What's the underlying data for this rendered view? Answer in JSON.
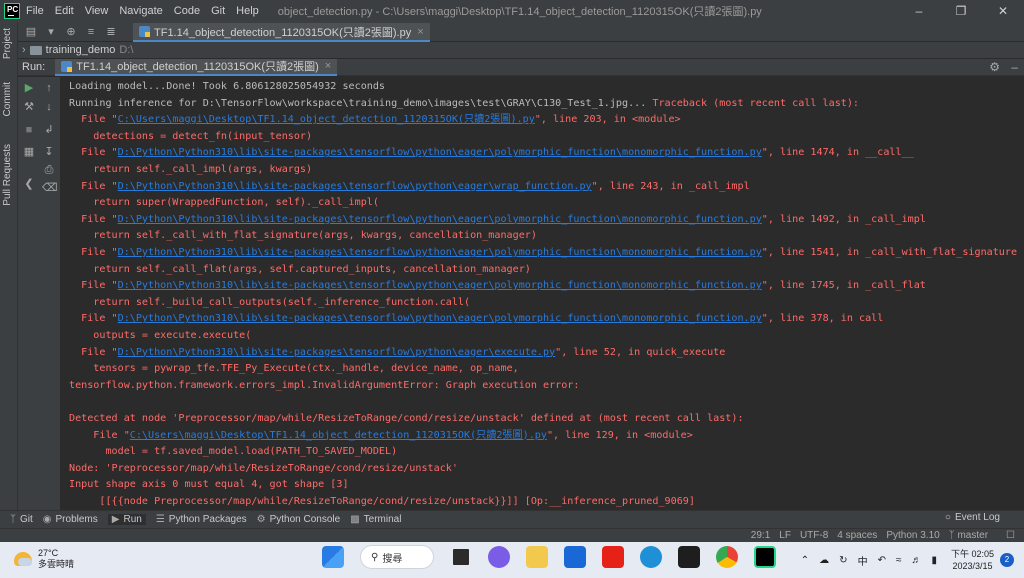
{
  "window": {
    "title": "object_detection.py - C:\\Users\\maggi\\Desktop\\TF1.14_object_detection_1120315OK(只讀2張圖).py",
    "menu": [
      "File",
      "Edit",
      "View",
      "Navigate",
      "Code",
      "Git",
      "Help"
    ]
  },
  "editor_tab": {
    "label": "TF1.14_object_detection_1120315OK(只讀2張圖).py"
  },
  "breadcrumb": {
    "project": "training_demo",
    "drive": "D:\\"
  },
  "left_strip": {
    "project": "Project",
    "commit": "Commit",
    "pull_requests": "Pull Requests"
  },
  "run_panel": {
    "label": "Run:",
    "tab": "TF1.14_object_detection_1120315OK(只讀2張圖)"
  },
  "console": [
    [
      {
        "t": "Loading model...Done! Took 6.806128025054932 seconds",
        "c": "norm"
      }
    ],
    [
      {
        "t": "Running inference for D:\\TensorFlow\\workspace\\training_demo\\images\\test\\GRAY\\C130_Test_1.jpg... ",
        "c": "norm"
      },
      {
        "t": "Traceback (most recent call last):",
        "c": "err"
      }
    ],
    [
      {
        "t": "  File \"",
        "c": "err"
      },
      {
        "t": "C:\\Users\\maggi\\Desktop\\TF1.14_object_detection_1120315OK(只讀2張圖).py",
        "c": "link"
      },
      {
        "t": "\", line 203, in <module>",
        "c": "err"
      }
    ],
    [
      {
        "t": "    detections = detect_fn(input_tensor)",
        "c": "err"
      }
    ],
    [
      {
        "t": "  File \"",
        "c": "err"
      },
      {
        "t": "D:\\Python\\Python310\\lib\\site-packages\\tensorflow\\python\\eager\\polymorphic_function\\monomorphic_function.py",
        "c": "link"
      },
      {
        "t": "\", line 1474, in __call__",
        "c": "err"
      }
    ],
    [
      {
        "t": "    return self._call_impl(args, kwargs)",
        "c": "err"
      }
    ],
    [
      {
        "t": "  File \"",
        "c": "err"
      },
      {
        "t": "D:\\Python\\Python310\\lib\\site-packages\\tensorflow\\python\\eager\\wrap_function.py",
        "c": "link"
      },
      {
        "t": "\", line 243, in _call_impl",
        "c": "err"
      }
    ],
    [
      {
        "t": "    return super(WrappedFunction, self)._call_impl(",
        "c": "err"
      }
    ],
    [
      {
        "t": "  File \"",
        "c": "err"
      },
      {
        "t": "D:\\Python\\Python310\\lib\\site-packages\\tensorflow\\python\\eager\\polymorphic_function\\monomorphic_function.py",
        "c": "link"
      },
      {
        "t": "\", line 1492, in _call_impl",
        "c": "err"
      }
    ],
    [
      {
        "t": "    return self._call_with_flat_signature(args, kwargs, cancellation_manager)",
        "c": "err"
      }
    ],
    [
      {
        "t": "  File \"",
        "c": "err"
      },
      {
        "t": "D:\\Python\\Python310\\lib\\site-packages\\tensorflow\\python\\eager\\polymorphic_function\\monomorphic_function.py",
        "c": "link"
      },
      {
        "t": "\", line 1541, in _call_with_flat_signature",
        "c": "err"
      }
    ],
    [
      {
        "t": "    return self._call_flat(args, self.captured_inputs, cancellation_manager)",
        "c": "err"
      }
    ],
    [
      {
        "t": "  File \"",
        "c": "err"
      },
      {
        "t": "D:\\Python\\Python310\\lib\\site-packages\\tensorflow\\python\\eager\\polymorphic_function\\monomorphic_function.py",
        "c": "link"
      },
      {
        "t": "\", line 1745, in _call_flat",
        "c": "err"
      }
    ],
    [
      {
        "t": "    return self._build_call_outputs(self._inference_function.call(",
        "c": "err"
      }
    ],
    [
      {
        "t": "  File \"",
        "c": "err"
      },
      {
        "t": "D:\\Python\\Python310\\lib\\site-packages\\tensorflow\\python\\eager\\polymorphic_function\\monomorphic_function.py",
        "c": "link"
      },
      {
        "t": "\", line 378, in call",
        "c": "err"
      }
    ],
    [
      {
        "t": "    outputs = execute.execute(",
        "c": "err"
      }
    ],
    [
      {
        "t": "  File \"",
        "c": "err"
      },
      {
        "t": "D:\\Python\\Python310\\lib\\site-packages\\tensorflow\\python\\eager\\execute.py",
        "c": "link"
      },
      {
        "t": "\", line 52, in quick_execute",
        "c": "err"
      }
    ],
    [
      {
        "t": "    tensors = pywrap_tfe.TFE_Py_Execute(ctx._handle, device_name, op_name,",
        "c": "err"
      }
    ],
    [
      {
        "t": "tensorflow.python.framework.errors_impl.InvalidArgumentError: Graph execution error:",
        "c": "err"
      }
    ],
    [
      {
        "t": "",
        "c": "err"
      }
    ],
    [
      {
        "t": "Detected at node 'Preprocessor/map/while/ResizeToRange/cond/resize/unstack' defined at (most recent call last):",
        "c": "err"
      }
    ],
    [
      {
        "t": "    File \"",
        "c": "err"
      },
      {
        "t": "C:\\Users\\maggi\\Desktop\\TF1.14_object_detection_1120315OK(只讀2張圖).py",
        "c": "link"
      },
      {
        "t": "\", line 129, in <module>",
        "c": "err"
      }
    ],
    [
      {
        "t": "      model = tf.saved_model.load(PATH_TO_SAVED_MODEL)",
        "c": "err"
      }
    ],
    [
      {
        "t": "Node: 'Preprocessor/map/while/ResizeToRange/cond/resize/unstack'",
        "c": "err"
      }
    ],
    [
      {
        "t": "Input shape axis 0 must equal 4, got shape [3]",
        "c": "err"
      }
    ],
    [
      {
        "t": "     [[{{node Preprocessor/map/while/ResizeToRange/cond/resize/unstack}}]] [Op:__inference_pruned_9069]",
        "c": "err"
      }
    ]
  ],
  "bottom_tabs": [
    {
      "label": "Git",
      "icon": "git-branch-icon"
    },
    {
      "label": "Problems",
      "icon": "problems-icon"
    },
    {
      "label": "Run",
      "icon": "run-icon"
    },
    {
      "label": "Python Packages",
      "icon": "packages-icon"
    },
    {
      "label": "Python Console",
      "icon": "console-icon"
    },
    {
      "label": "Terminal",
      "icon": "terminal-icon"
    }
  ],
  "event_log": "Event Log",
  "status": {
    "position": "29:1",
    "line_sep": "LF",
    "encoding": "UTF-8",
    "indent": "4 spaces",
    "interpreter": "Python 3.10",
    "branch": "master"
  },
  "taskbar": {
    "temperature": "27°C",
    "weather": "多雲時晴",
    "search": "搜尋",
    "ime": "中",
    "time": "下午 02:05",
    "date": "2023/3/15",
    "notifications": "2"
  },
  "colors": {
    "accent": "#4a88c7",
    "error": "#ff6b68",
    "link": "#287bde"
  }
}
